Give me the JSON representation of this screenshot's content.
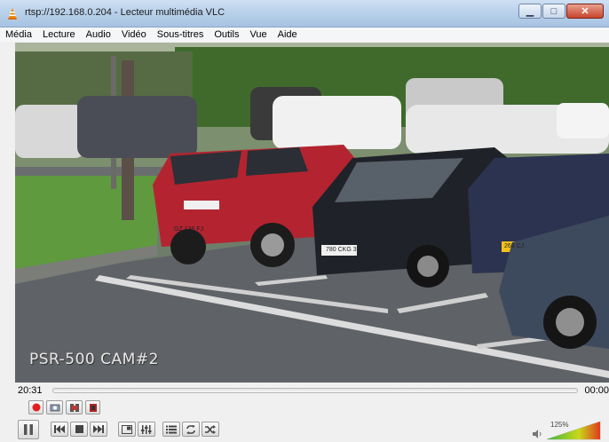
{
  "window": {
    "title": "rtsp://192.168.0.204 - Lecteur multimédia VLC",
    "minimize": "▁",
    "maximize": "□",
    "close": "✕"
  },
  "menu": [
    "Média",
    "Lecture",
    "Audio",
    "Vidéo",
    "Sous-titres",
    "Outils",
    "Vue",
    "Aide"
  ],
  "video": {
    "osd_text": "PSR-500 CAM#2",
    "plates": [
      "GZ 136 FJ",
      "780 CKG 31",
      "268 CJ"
    ]
  },
  "playback": {
    "time_elapsed": "20:31",
    "time_total": "00:00",
    "progress": 0
  },
  "audio": {
    "volume_label": "125%",
    "volume_percent": 125
  },
  "colors": {
    "accent": "#f08a00",
    "record": "#e02020",
    "volume_low": "#3cb43c",
    "volume_high": "#e03a1e"
  }
}
